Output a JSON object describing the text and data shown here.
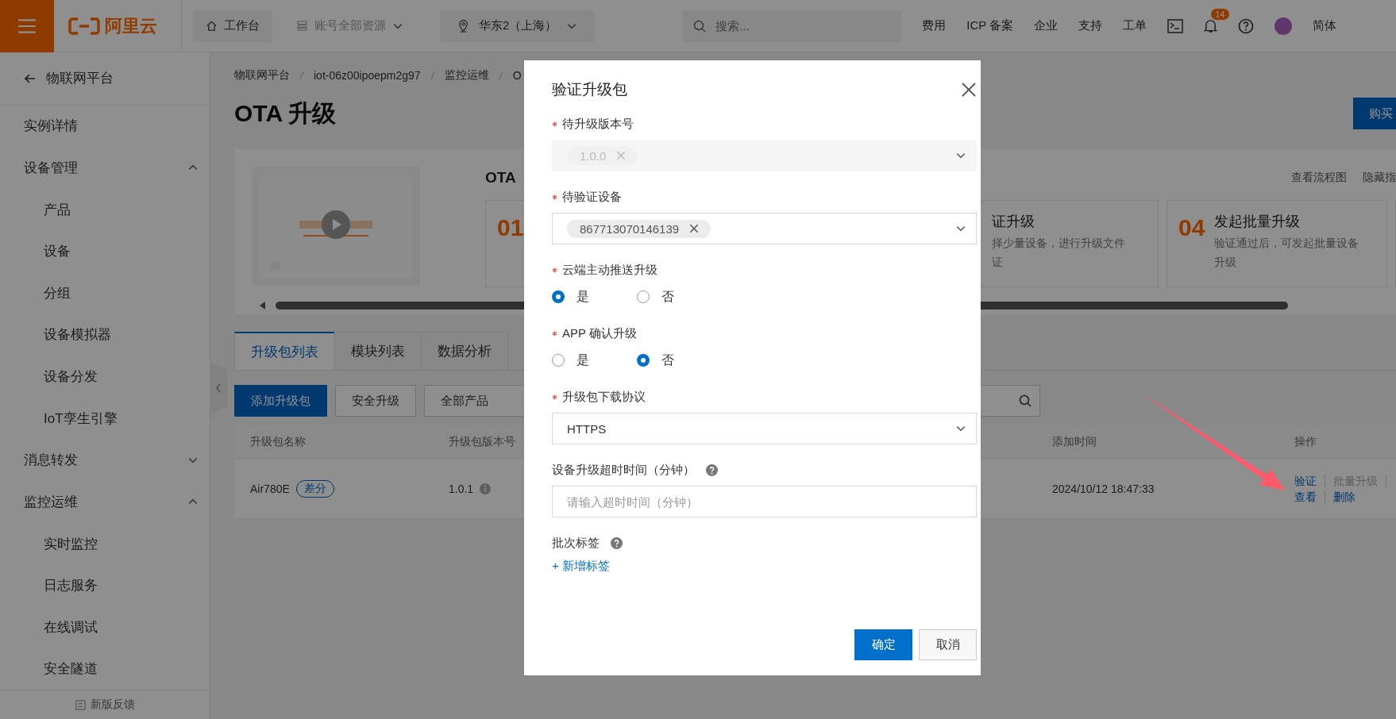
{
  "top_bar": {
    "logo": "阿里云",
    "workbench": "工作台",
    "resources": "账号全部资源",
    "region": "华东2（上海）",
    "search": {
      "placeholder": "搜索..."
    },
    "links": [
      "费用",
      "ICP 备案",
      "企业",
      "支持",
      "工单"
    ],
    "notifications": {
      "badge": "14"
    },
    "language": "简体"
  },
  "sidebar": {
    "back": "物联网平台",
    "items": [
      {
        "label": "实例详情"
      },
      {
        "label": "设备管理",
        "expanded": true,
        "children": [
          {
            "label": "产品"
          },
          {
            "label": "设备"
          },
          {
            "label": "分组"
          },
          {
            "label": "设备模拟器"
          },
          {
            "label": "设备分发"
          },
          {
            "label": "IoT孪生引擎"
          }
        ]
      },
      {
        "label": "消息转发",
        "expanded": false
      },
      {
        "label": "监控运维",
        "expanded": true,
        "children": [
          {
            "label": "实时监控"
          },
          {
            "label": "日志服务"
          },
          {
            "label": "在线调试"
          },
          {
            "label": "安全隧道"
          }
        ]
      }
    ],
    "feedback": "新版反馈"
  },
  "breadcrumb": [
    "物联网平台",
    "iot-06z00ipoepm2g97",
    "监控运维",
    "O"
  ],
  "page_title": "OTA 升级",
  "buy_button": "购买",
  "guide": {
    "title": "OTA",
    "links": [
      "查看流程图",
      "隐藏指"
    ],
    "steps": [
      {
        "number": "01"
      },
      {
        "title": "证升级",
        "lines": [
          "择少量设备，进行升级文件",
          "证"
        ]
      },
      {
        "number": "04",
        "title": "发起批量升级",
        "lines": [
          "验证通过后，可发起批量设备",
          "升级"
        ]
      }
    ]
  },
  "tabs": [
    {
      "label": "升级包列表",
      "selected": true
    },
    {
      "label": "模块列表",
      "selected": false
    },
    {
      "label": "数据分析",
      "selected": false
    }
  ],
  "toolbar": {
    "add_button": "添加升级包",
    "secure_button": "安全升级",
    "product_filter": "全部产品"
  },
  "table": {
    "columns": [
      "升级包名称",
      "升级包版本号",
      "添加时间",
      "操作"
    ],
    "rows": [
      {
        "name": "Air780E",
        "tag": "差分",
        "version": "1.0.1",
        "added": "2024/10/12 18:47:33",
        "actions": [
          {
            "label": "验证",
            "disabled": false
          },
          {
            "label": "批量升级",
            "disabled": true
          },
          {
            "label": "查看",
            "disabled": false
          },
          {
            "label": "删除",
            "disabled": false
          }
        ]
      }
    ]
  },
  "modal": {
    "title": "验证升级包",
    "fields": [
      {
        "kind": "select",
        "label": "待升级版本号",
        "required": true,
        "disabled": true,
        "tags": [
          "1.0.0"
        ]
      },
      {
        "kind": "select",
        "label": "待验证设备",
        "required": true,
        "disabled": false,
        "tags": [
          "867713070146139"
        ]
      },
      {
        "kind": "radio",
        "label": "云端主动推送升级",
        "required": true,
        "options": [
          {
            "label": "是",
            "selected": true
          },
          {
            "label": "否",
            "selected": false
          }
        ]
      },
      {
        "kind": "radio",
        "label": "APP 确认升级",
        "required": true,
        "options": [
          {
            "label": "是",
            "selected": false
          },
          {
            "label": "否",
            "selected": true
          }
        ]
      },
      {
        "kind": "select",
        "label": "升级包下载协议",
        "required": true,
        "disabled": false,
        "value": "HTTPS"
      },
      {
        "kind": "input",
        "label": "设备升级超时时间（分钟）",
        "required": false,
        "help": true,
        "placeholder": "请输入超时时间（分钟）"
      },
      {
        "kind": "tags",
        "label": "批次标签",
        "required": false,
        "help": true,
        "add_link": "+ 新增标签"
      }
    ],
    "buttons": [
      {
        "label": "确定",
        "primary": true
      },
      {
        "label": "取消",
        "primary": false
      }
    ]
  }
}
